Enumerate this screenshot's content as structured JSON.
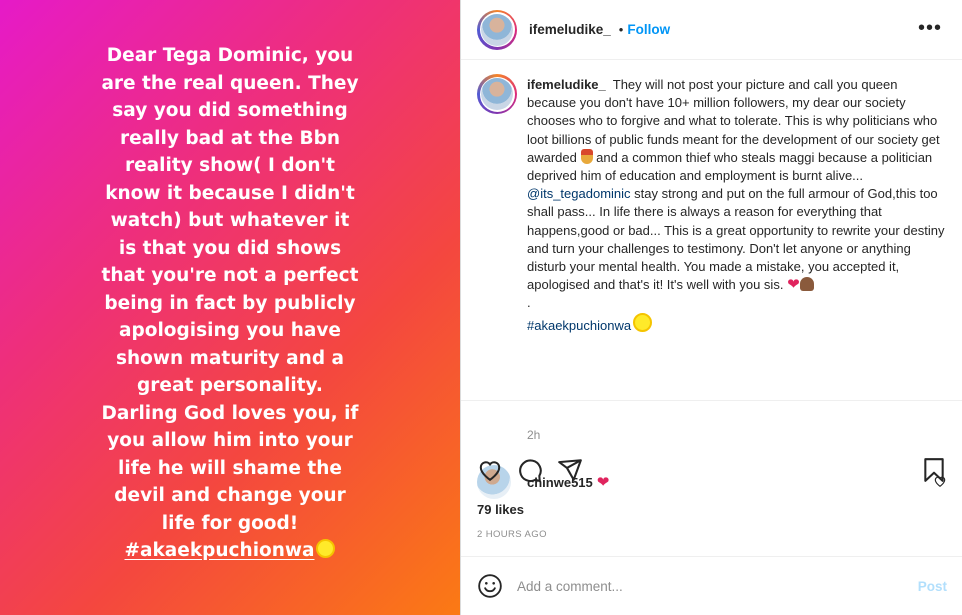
{
  "story": {
    "lines": [
      "Dear Tega Dominic, you",
      "are the real queen. They",
      "say you did something",
      "really bad at the Bbn",
      "reality show( I don't",
      "know it because  I didn't",
      "watch) but whatever it",
      "is that you did shows",
      "that you're not a perfect",
      "being in fact by publicly",
      "apologising you have",
      "shown maturity and a",
      "great personality.",
      "Darling God loves you, if",
      "you allow him into your",
      "life he will shame the",
      "devil and change your",
      "life for good!"
    ],
    "hashtag": "#akaekpuchionwa"
  },
  "header": {
    "username": "ifemeludike_",
    "separator": "•",
    "follow_label": "Follow",
    "more_label": "•••"
  },
  "caption": {
    "username": "ifemeludike_",
    "text_1": "They will not post your picture and call you queen because you don't have 10+ million followers, my dear our society chooses who to forgive and what to tolerate. This is why politicians who loot billions of public funds meant for the development of our society get awarded",
    "text_2": "and a common thief who steals maggi because a politician deprived him of education and employment is burnt alive... ",
    "mention": "@its_tegadominic",
    "text_3": " stay strong and put on the full armour of God,this too shall pass... In life there is always a reason for everything that happens,good or bad... This is a great opportunity to rewrite your destiny and turn your challenges to testimony. Don't let anyone or anything disturb your mental health. You made a mistake, you accepted it, apologised and that's it! It's well with you sis.",
    "dot": ".",
    "hashtag": "#akaekpuchionwa",
    "time": "2h"
  },
  "comment": {
    "username": "chinwe515",
    "emoji": "❤"
  },
  "likes": "79 likes",
  "posted": "2 HOURS AGO",
  "add_comment": {
    "placeholder": "Add a comment...",
    "post_label": "Post"
  },
  "colors": {
    "link_blue": "#0095f6",
    "mention_blue": "#00376b",
    "muted": "#8e8e8e"
  }
}
